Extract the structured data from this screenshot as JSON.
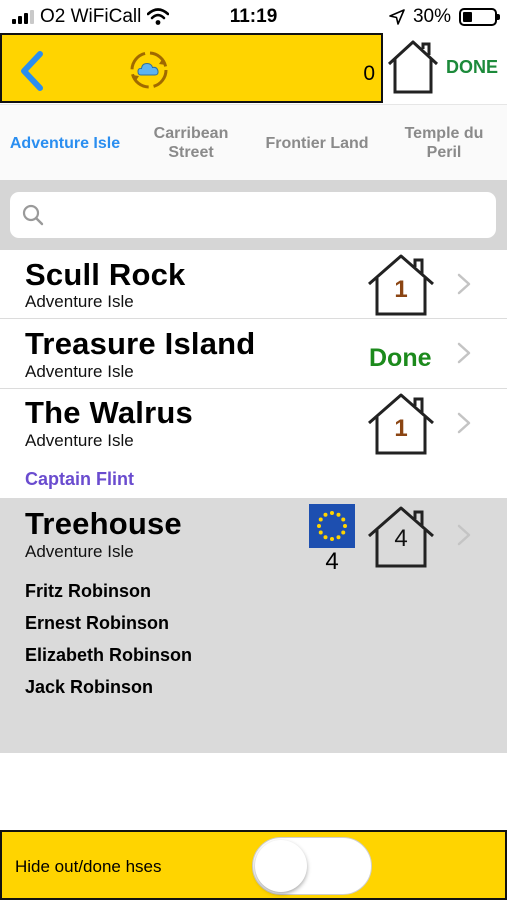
{
  "status_bar": {
    "carrier": "O2 WiFiCall",
    "time": "11:19",
    "battery_percent": "30%",
    "battery_level": 0.3
  },
  "header": {
    "count": "0",
    "done_label": "DONE",
    "accent_color": "#ffd400",
    "back_icon": "chevron-left-icon",
    "sync_icon": "cloud-sync-icon",
    "home_icon": "house-icon"
  },
  "tabs": [
    {
      "label": "Adventure Isle",
      "active": true
    },
    {
      "label": "Carribean Street",
      "active": false
    },
    {
      "label": "Frontier Land",
      "active": false
    },
    {
      "label": "Temple du Peril",
      "active": false
    }
  ],
  "search": {
    "placeholder": "",
    "value": ""
  },
  "rows": [
    {
      "title": "Scull Rock",
      "subtitle": "Adventure Isle",
      "house_count": "1"
    },
    {
      "title": "Treasure Island",
      "subtitle": "Adventure Isle",
      "status": "Done"
    },
    {
      "title": "The Walrus",
      "subtitle": "Adventure Isle",
      "house_count": "1"
    }
  ],
  "group_header": "Captain Flint",
  "treehouse": {
    "title": "Treehouse",
    "subtitle": "Adventure Isle",
    "flag_count": "4",
    "house_count": "4",
    "members": [
      "Fritz Robinson",
      "Ernest Robinson",
      "Elizabeth Robinson",
      "Jack Robinson"
    ]
  },
  "bottom_bar": {
    "label": "Hide out/done hses",
    "toggle_on": false
  },
  "colors": {
    "done_green": "#1c8a1c",
    "tab_active": "#2a8ef0",
    "group_purple": "#6a4ccf",
    "house_number_brown": "#8b4513"
  }
}
